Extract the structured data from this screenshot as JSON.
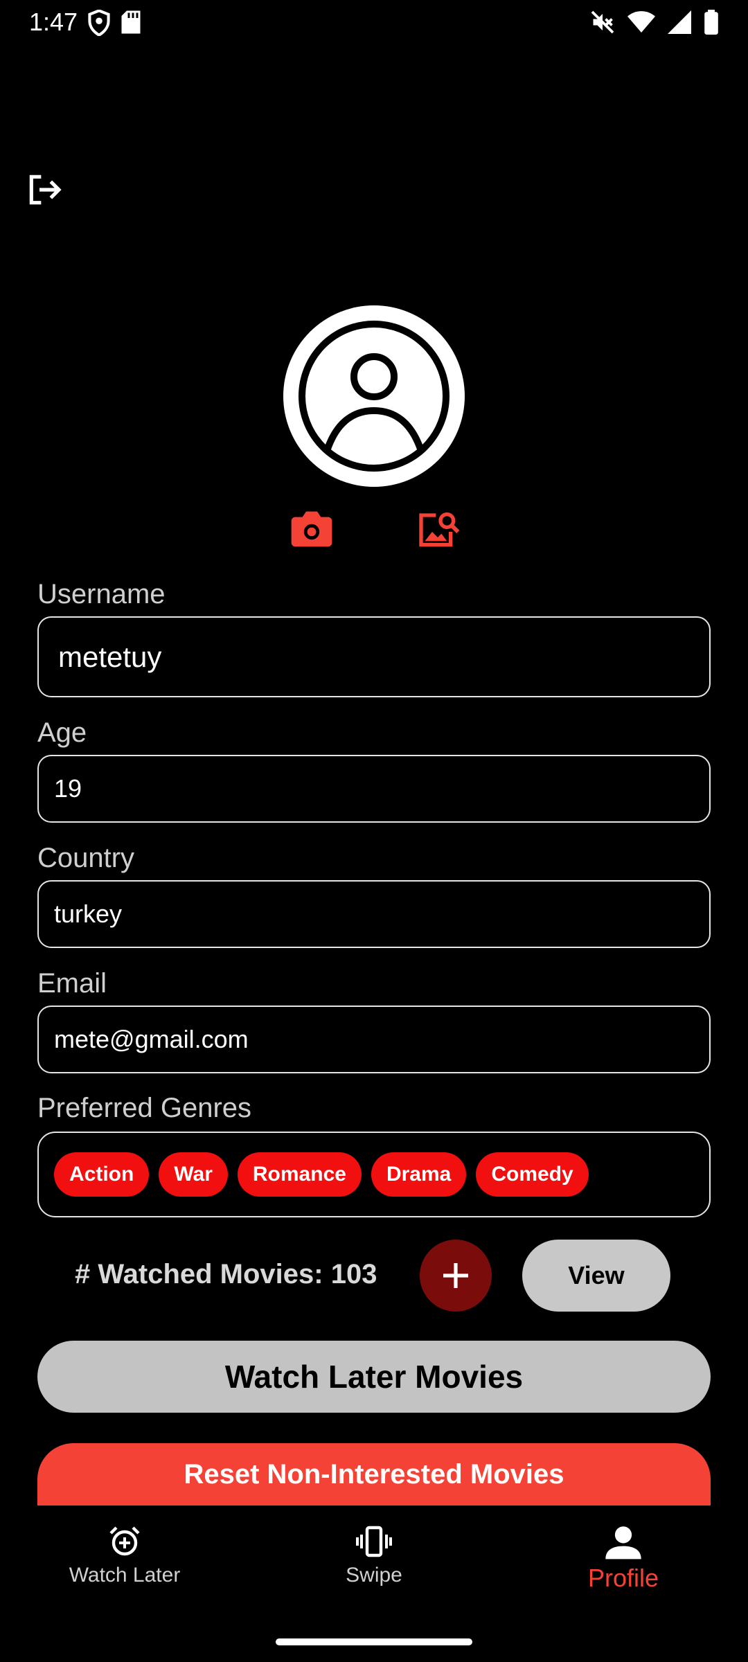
{
  "status_bar": {
    "time": "1:47"
  },
  "icons": {
    "logout": "logout-icon",
    "avatar": "account-circle-icon",
    "camera": "camera-icon",
    "gallery": "image-search-icon",
    "add": "plus-icon"
  },
  "form": {
    "username": {
      "label": "Username",
      "value": "metetuy"
    },
    "age": {
      "label": "Age",
      "value": "19"
    },
    "country": {
      "label": "Country",
      "value": "turkey"
    },
    "email": {
      "label": "Email",
      "value": "mete@gmail.com"
    },
    "genres": {
      "label": "Preferred Genres",
      "items": [
        "Action",
        "War",
        "Romance",
        "Drama",
        "Comedy"
      ]
    }
  },
  "watched": {
    "label": "# Watched Movies: 103",
    "view_label": "View"
  },
  "buttons": {
    "watch_later": "Watch Later Movies",
    "reset": "Reset Non-Interested Movies"
  },
  "nav": {
    "items": [
      {
        "label": "Watch Later",
        "icon": "alarm-add-icon"
      },
      {
        "label": "Swipe",
        "icon": "vibration-icon"
      },
      {
        "label": "Profile",
        "icon": "person-icon",
        "active": true
      }
    ]
  },
  "colors": {
    "accent": "#f44336",
    "chip": "#f20f0f",
    "add_button": "#7a0c0c",
    "grey_button": "#c3c3c3"
  }
}
